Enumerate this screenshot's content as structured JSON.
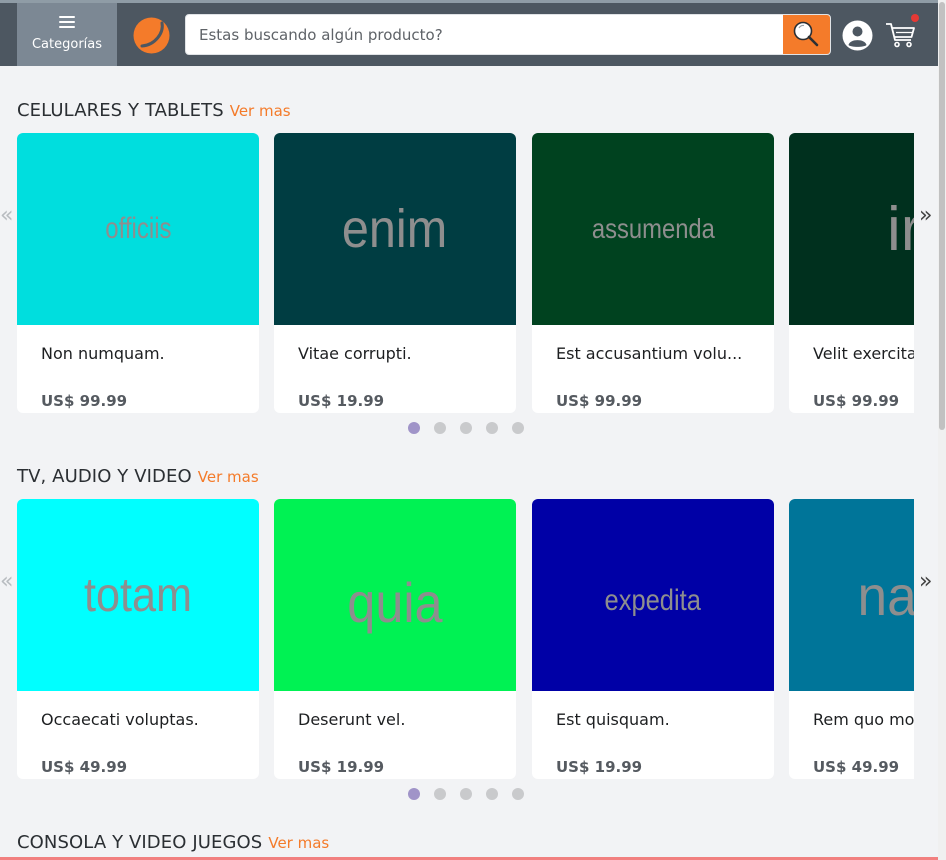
{
  "header": {
    "categories_label": "Categorías",
    "search_placeholder": "Estas buscando algún producto?",
    "colors": {
      "bar": "#4d5761",
      "accent": "#f47b2a"
    }
  },
  "sections": [
    {
      "title": "CELULARES Y TABLETS",
      "more": "Ver mas",
      "products": [
        {
          "thumb": "officiis",
          "color": "#00dede",
          "name": "Non numquam.",
          "price": "US$ 99.99"
        },
        {
          "thumb": "enim",
          "color": "#003d42",
          "name": "Vitae corrupti.",
          "price": "US$ 19.99"
        },
        {
          "thumb": "assumenda",
          "color": "#00421f",
          "name": "Est accusantium volu...",
          "price": "US$ 99.99"
        },
        {
          "thumb": "ir",
          "color": "#00301e",
          "name": "Velit exercita",
          "price": "US$ 99.99"
        }
      ]
    },
    {
      "title": "TV, AUDIO Y VIDEO",
      "more": "Ver mas",
      "products": [
        {
          "thumb": "totam",
          "color": "#00ffff",
          "name": "Occaecati voluptas.",
          "price": "US$ 49.99"
        },
        {
          "thumb": "quia",
          "color": "#00f253",
          "name": "Deserunt vel.",
          "price": "US$ 19.99"
        },
        {
          "thumb": "expedita",
          "color": "#0000a6",
          "name": "Est quisquam.",
          "price": "US$ 19.99"
        },
        {
          "thumb": "na",
          "color": "#007599",
          "name": "Rem quo mo",
          "price": "US$ 49.99"
        }
      ]
    },
    {
      "title": "CONSOLA Y VIDEO JUEGOS",
      "more": "Ver mas",
      "products": []
    }
  ],
  "carousel": {
    "arrow_prev": "«",
    "arrow_next": "»",
    "pages": 5,
    "active_page": 1
  }
}
